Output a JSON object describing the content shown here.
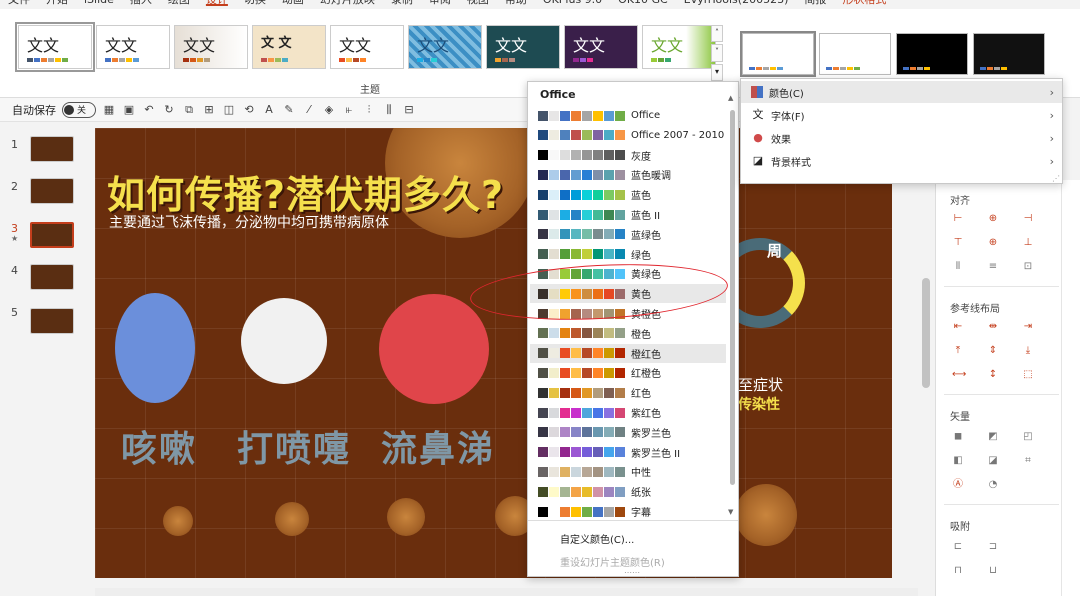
{
  "tabs": [
    "文件",
    "开始",
    "iSlide",
    "插入",
    "绘图",
    "设计",
    "切换",
    "动画",
    "幻灯片放映",
    "录制",
    "审阅",
    "视图",
    "帮助",
    "OKPlus 9.0",
    "OK10 GC",
    "EvynTools(200523)",
    "简报",
    "形状格式"
  ],
  "ribbon": {
    "group_label": "主题",
    "theme_text": "文文",
    "theme_text_alt": "文 文"
  },
  "qat": {
    "autosave_label": "自动保存",
    "autosave_state": "关"
  },
  "slides": {
    "numbers": [
      "1",
      "2",
      "3",
      "4",
      "5"
    ],
    "selected": "3",
    "star": "★"
  },
  "slide": {
    "title": "如何传播?潜伏期多久?",
    "subtitle": "主要通过飞沫传播，分泌物中均可携带病原体",
    "words": [
      "咳嗽",
      "打喷嚏",
      "流鼻涕"
    ],
    "zhou": "周",
    "zhengzhuang": "至症状",
    "chuanranxing": "传染性"
  },
  "dropdown": {
    "header": "Office",
    "items": [
      {
        "name": "Office",
        "colors": [
          "#44546a",
          "#e7e6e6",
          "#4472c4",
          "#ed7d31",
          "#a5a5a5",
          "#ffc000",
          "#5b9bd5",
          "#70ad47"
        ]
      },
      {
        "name": "Office 2007 - 2010",
        "colors": [
          "#1f497d",
          "#eeece1",
          "#4f81bd",
          "#c0504d",
          "#9bbb59",
          "#8064a2",
          "#4bacc6",
          "#f79646"
        ]
      },
      {
        "name": "灰度",
        "colors": [
          "#000000",
          "#f8f8f8",
          "#dddddd",
          "#b2b2b2",
          "#969696",
          "#808080",
          "#5f5f5f",
          "#4d4d4d"
        ]
      },
      {
        "name": "蓝色暖调",
        "colors": [
          "#242852",
          "#acccea",
          "#4a66ac",
          "#629dd1",
          "#297fd5",
          "#7f8fa9",
          "#5aa2ae",
          "#9d90a0"
        ]
      },
      {
        "name": "蓝色",
        "colors": [
          "#17406d",
          "#dbeff9",
          "#0f6fc6",
          "#009dd9",
          "#0bd0d9",
          "#10cf9b",
          "#7cca62",
          "#a5c249"
        ]
      },
      {
        "name": "蓝色 II",
        "colors": [
          "#335b74",
          "#dfe3e5",
          "#1cade4",
          "#2683c6",
          "#27ced7",
          "#42ba97",
          "#3e8853",
          "#62a39f"
        ]
      },
      {
        "name": "蓝绿色",
        "colors": [
          "#373545",
          "#dceaea",
          "#3494ba",
          "#58b6c0",
          "#75bda7",
          "#7a8c8e",
          "#84acb6",
          "#2683c6"
        ]
      },
      {
        "name": "绿色",
        "colors": [
          "#455f51",
          "#e3ded1",
          "#549e39",
          "#8ab833",
          "#c0cf3a",
          "#029676",
          "#4ab5c4",
          "#0989b1"
        ]
      },
      {
        "name": "黄绿色",
        "colors": [
          "#455f51",
          "#e3ded1",
          "#99cb38",
          "#63a537",
          "#37a76f",
          "#44c1a3",
          "#4eb3cf",
          "#51c3f9"
        ]
      },
      {
        "name": "黄色",
        "colors": [
          "#39302a",
          "#e5dec3",
          "#ffca08",
          "#f8931d",
          "#ce8d3e",
          "#ec7016",
          "#e64823",
          "#9c6a6a"
        ]
      },
      {
        "name": "黄橙色",
        "colors": [
          "#4e3b30",
          "#fbeec9",
          "#f0a22e",
          "#a5644e",
          "#b58b80",
          "#c3986d",
          "#a19574",
          "#c17529"
        ]
      },
      {
        "name": "橙色",
        "colors": [
          "#637052",
          "#ccddea",
          "#e48312",
          "#bd582c",
          "#865640",
          "#9b8357",
          "#c2bc80",
          "#94a088"
        ]
      },
      {
        "name": "橙红色",
        "colors": [
          "#505046",
          "#eeece1",
          "#e84c22",
          "#ffbd47",
          "#b64926",
          "#ff8427",
          "#cc9900",
          "#b22600"
        ]
      },
      {
        "name": "红橙色",
        "colors": [
          "#505046",
          "#f2eecb",
          "#e84c22",
          "#ffbd47",
          "#b64926",
          "#ff8427",
          "#cc9900",
          "#b22600"
        ]
      },
      {
        "name": "红色",
        "colors": [
          "#323232",
          "#e5c243",
          "#a5300f",
          "#d55816",
          "#e19825",
          "#b19c7d",
          "#7f5f52",
          "#b27d49"
        ]
      },
      {
        "name": "紫红色",
        "colors": [
          "#454551",
          "#d8d9dc",
          "#e32d91",
          "#c830cc",
          "#4ea6dc",
          "#4775e7",
          "#8971e1",
          "#d54773"
        ]
      },
      {
        "name": "紫罗兰色",
        "colors": [
          "#373545",
          "#dcd8dc",
          "#ad84c6",
          "#8784c7",
          "#5d739a",
          "#6997af",
          "#84acb6",
          "#6f8183"
        ]
      },
      {
        "name": "紫罗兰色 II",
        "colors": [
          "#632e62",
          "#eae5eb",
          "#92278f",
          "#9b57d3",
          "#755dd9",
          "#665eb8",
          "#45a5ed",
          "#5982db"
        ]
      },
      {
        "name": "中性",
        "colors": [
          "#696464",
          "#e9e5dc",
          "#dfb162",
          "#cad6dd",
          "#b7a796",
          "#a39382",
          "#9fb8c0",
          "#79918e"
        ]
      },
      {
        "name": "纸张",
        "colors": [
          "#444d26",
          "#fefac9",
          "#a5b592",
          "#f3a447",
          "#e7bc29",
          "#d092a7",
          "#9c85c0",
          "#809ec2"
        ]
      },
      {
        "name": "字幕",
        "colors": [
          "#000000",
          "#ffffff",
          "#ed7d31",
          "#ffc000",
          "#70ad47",
          "#4472c4",
          "#a5a5a5",
          "#9e480e"
        ]
      }
    ],
    "custom": "自定义颜色(C)...",
    "reset": "重设幻灯片主题颜色(R)"
  },
  "menu2": {
    "items": [
      {
        "icon": "color-palette-icon",
        "label": "颜色(C)"
      },
      {
        "icon": "font-icon",
        "label": "字体(F)"
      },
      {
        "icon": "effects-icon",
        "label": "效果"
      },
      {
        "icon": "background-style-icon",
        "label": "背景样式"
      }
    ]
  },
  "rpanel": {
    "align_label": "对齐",
    "guides_label": "参考线布局",
    "vector_label": "矢量",
    "snap_label": "吸附"
  }
}
